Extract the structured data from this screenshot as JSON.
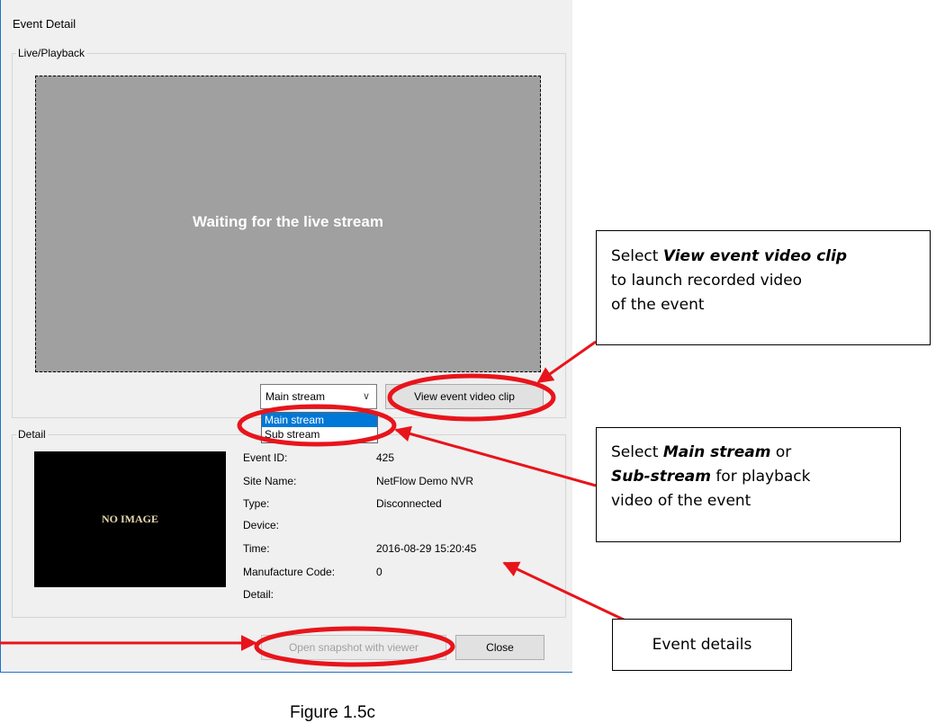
{
  "window": {
    "title": "Event Detail"
  },
  "live_group": {
    "legend": "Live/Playback",
    "video_message": "Waiting for the live stream"
  },
  "stream_select": {
    "value": "Main stream",
    "options": [
      "Main stream",
      "Sub stream"
    ],
    "selected_option": "Main stream"
  },
  "buttons": {
    "view_clip": "View event video clip",
    "open_snapshot": "Open snapshot with viewer",
    "close": "Close"
  },
  "detail_group": {
    "legend": "Detail",
    "snapshot_text": "NO IMAGE",
    "fields": [
      {
        "label": "Event ID:",
        "value": "425"
      },
      {
        "label": "Site Name:",
        "value": "NetFlow Demo NVR"
      },
      {
        "label": "Type:",
        "value": "Disconnected"
      },
      {
        "label": "Device:",
        "value": ""
      },
      {
        "label": "Time:",
        "value": "2016-08-29 15:20:45"
      },
      {
        "label": "Manufacture Code:",
        "value": "0"
      },
      {
        "label": "Detail:",
        "value": ""
      }
    ]
  },
  "callouts": {
    "view_clip": {
      "prefix": "Select ",
      "emph": "View event video clip",
      "rest1": "to launch recorded video",
      "rest2": "of the event"
    },
    "stream": {
      "prefix": "Select ",
      "emph1": "Main stream",
      "mid": " or",
      "emph2": "Sub-stream",
      "rest1": " for playback",
      "rest2": "video of the event"
    },
    "details": {
      "text": "Event details"
    }
  },
  "caption": "Figure 1.5c",
  "colors": {
    "annotation": "#e8141b",
    "highlight": "#0078d7",
    "video_bg": "#a0a0a0"
  }
}
